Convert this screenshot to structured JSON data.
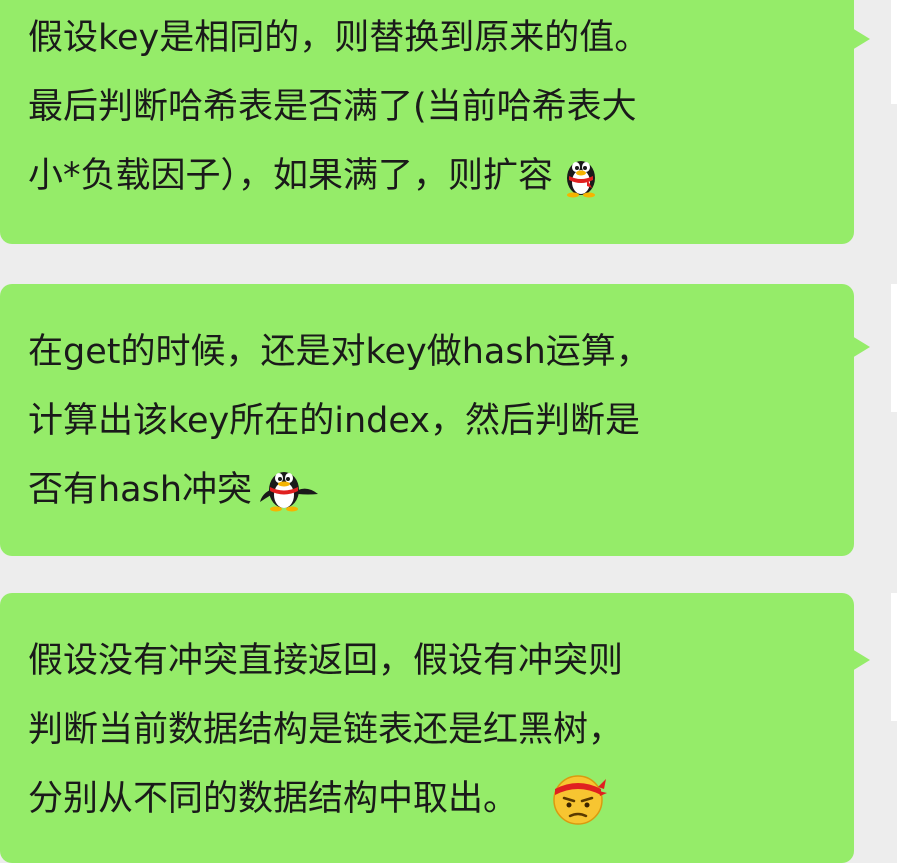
{
  "messages": [
    {
      "lines": [
        "假设key是相同的，则替换到原来的值。",
        "最后判断哈希表是否满了(当前哈希表大",
        "小*负载因子），如果满了，则扩容"
      ],
      "emoji": "qq-penguin-icon"
    },
    {
      "lines": [
        "在get的时候，还是对key做hash运算，",
        "计算出该key所在的index，然后判断是",
        "否有hash冲突"
      ],
      "emoji": "qq-penguin-icon"
    },
    {
      "lines": [
        "假设没有冲突直接返回，假设有冲突则",
        "判断当前数据结构是链表还是红黑树，",
        "分别从不同的数据结构中取出。"
      ],
      "emoji": "headband-frown-face-icon"
    }
  ],
  "colors": {
    "background": "#ededed",
    "bubble": "#95ec69",
    "text": "#1a1a1a",
    "avatar_edge": "#ffffff"
  }
}
